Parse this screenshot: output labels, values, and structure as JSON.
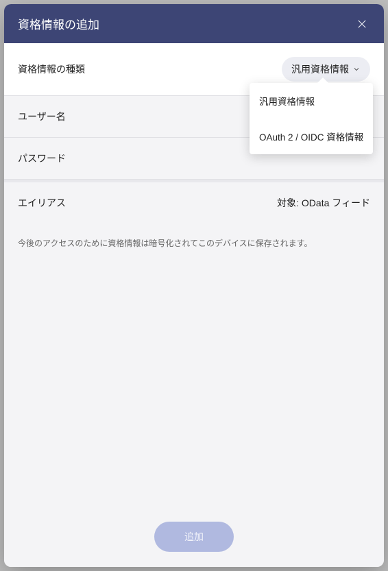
{
  "modal": {
    "title": "資格情報の追加"
  },
  "typeRow": {
    "label": "資格情報の種類",
    "selected": "汎用資格情報"
  },
  "dropdown": {
    "options": [
      "汎用資格情報",
      "OAuth 2 / OIDC 資格情報"
    ]
  },
  "usernameRow": {
    "label": "ユーザー名"
  },
  "passwordRow": {
    "label": "パスワード"
  },
  "aliasRow": {
    "label": "エイリアス",
    "value": "対象: OData フィード"
  },
  "hint": "今後のアクセスのために資格情報は暗号化されてこのデバイスに保存されます。",
  "footer": {
    "addButton": "追加"
  }
}
